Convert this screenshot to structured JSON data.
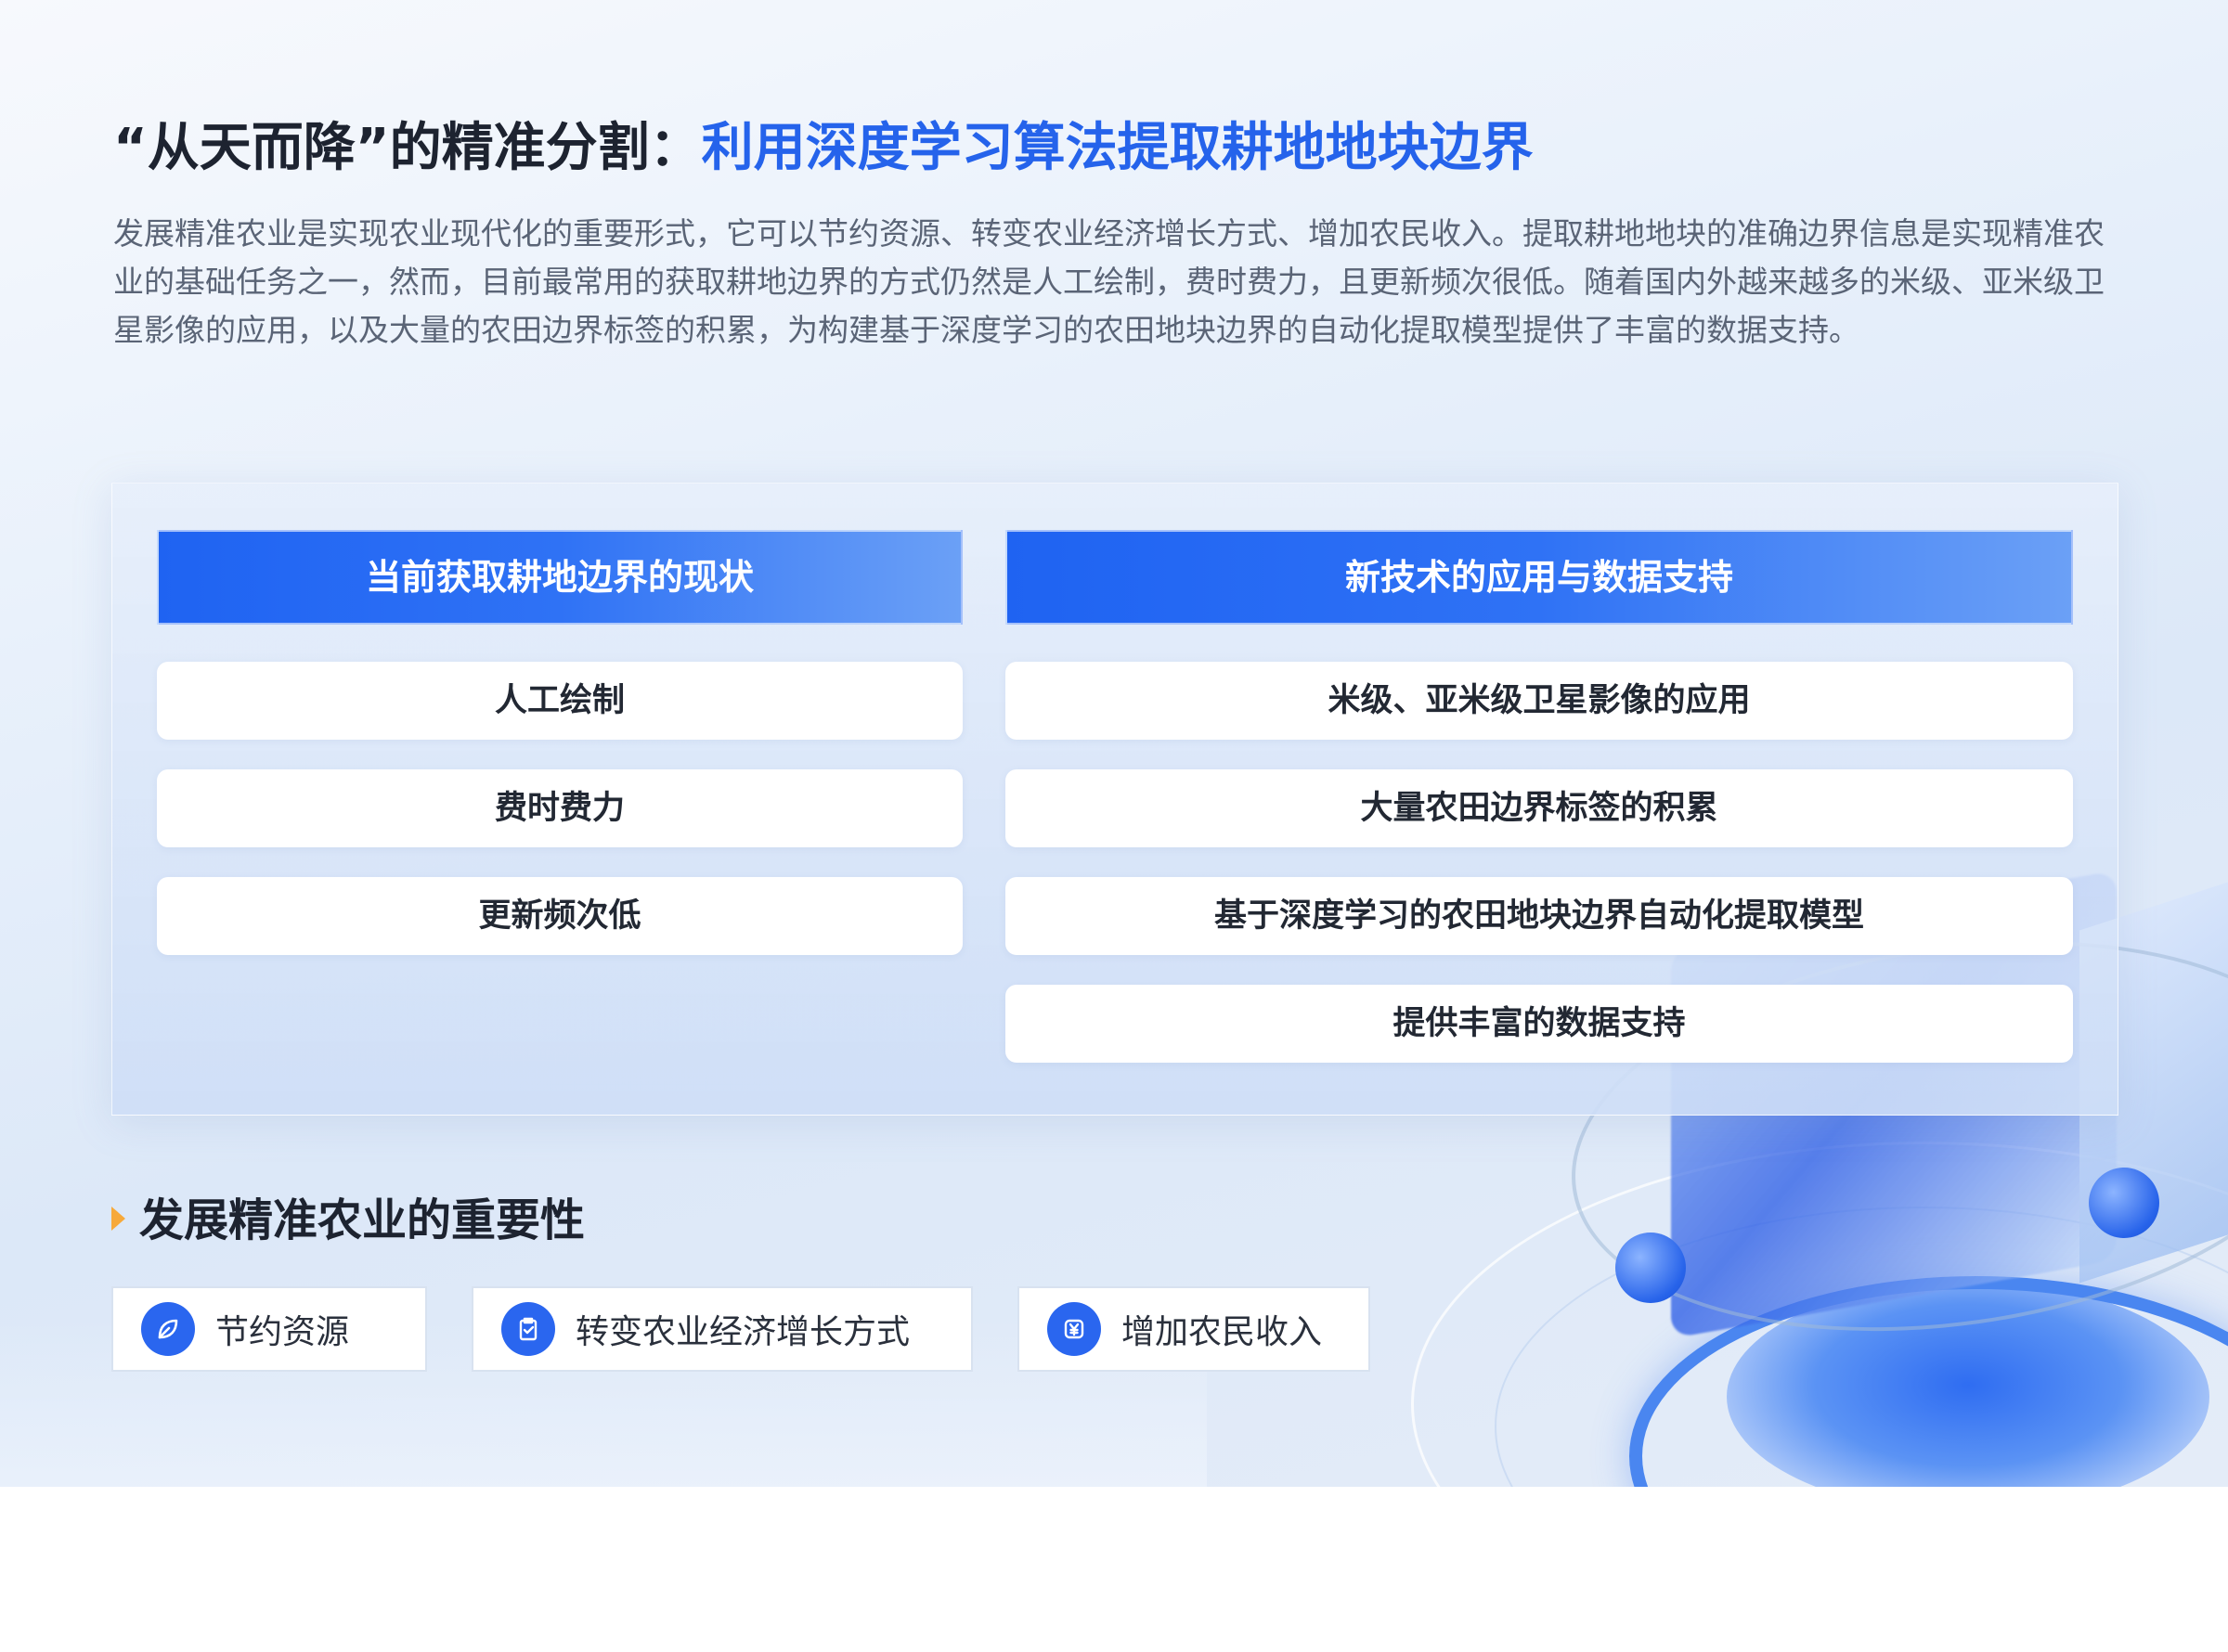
{
  "header": {
    "title_prefix": "“从天而降”的精准分割：",
    "title_accent": "利用深度学习算法提取耕地地块边界",
    "intro": "发展精准农业是实现农业现代化的重要形式，它可以节约资源、转变农业经济增长方式、增加农民收入。提取耕地地块的准确边界信息是实现精准农业的基础任务之一，然而，目前最常用的获取耕地边界的方式仍然是人工绘制，费时费力，且更新频次很低。随着国内外越来越多的米级、亚米级卫星影像的应用，以及大量的农田边界标签的积累，为构建基于深度学习的农田地块边界的自动化提取模型提供了丰富的数据支持。"
  },
  "comparison": {
    "left": {
      "heading": "当前获取耕地边界的现状",
      "items": [
        "人工绘制",
        "费时费力",
        "更新频次低"
      ]
    },
    "right": {
      "heading": "新技术的应用与数据支持",
      "items": [
        "米级、亚米级卫星影像的应用",
        "大量农田边界标签的积累",
        "基于深度学习的农田地块边界自动化提取模型",
        "提供丰富的数据支持"
      ]
    }
  },
  "importance": {
    "title": "发展精准农业的重要性",
    "items": [
      {
        "label": "节约资源",
        "icon": "leaf-icon"
      },
      {
        "label": "转变农业经济增长方式",
        "icon": "clipboard-check-icon"
      },
      {
        "label": "增加农民收入",
        "icon": "yuan-icon"
      }
    ]
  },
  "colors": {
    "accent": "#2563eb",
    "heading_gradient_start": "#1f63f2",
    "heading_gradient_end": "#6ba0f6",
    "marker": "#f7a93a",
    "icon_bg": "#2a66ef"
  }
}
